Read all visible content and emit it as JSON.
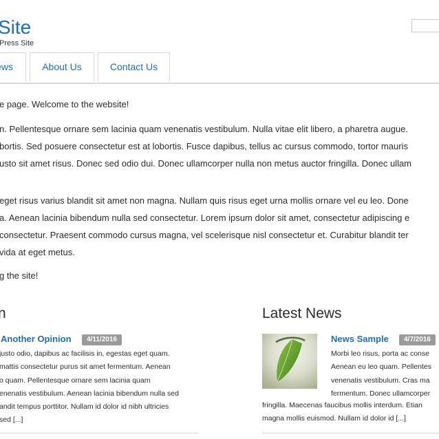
{
  "header": {
    "site_title": "Site",
    "tagline": "Press Site",
    "search": {
      "placeholder": ""
    }
  },
  "nav": {
    "items": [
      {
        "label": "ews"
      },
      {
        "label": "About Us"
      },
      {
        "label": "Contact Us"
      }
    ]
  },
  "content": {
    "intro": "e page. Welcome to the website!",
    "paragraph1": [
      "n. Pellentesque ornare sem lacinia quam venenatis vestibulum. Nulla vitae elit libero, a pharetra augue.",
      "bortis. Sed posuere consectetur est at lobortis. Fusce dapibus, tellus ac cursus commodo, tortor mauris",
      "usto sit amet risus. Donec sed odio dui. Donec ullamcorper nulla non metus auctor fringilla. Donec ullam"
    ],
    "paragraph2": [
      " eget risus varius blandit sit amet non magna. Nullam quis risus eget urna mollis ornare vel eu leo. Done",
      "a. Aenean lacinia bibendum nulla sed consectetur. Lorem ipsum dolor sit amet, consectetur adipiscing e",
      " consectetur. Praesent commodo cursus magna, vel scelerisque nisl consectetur et. Curabitur blandit ter",
      "vida at eget metus."
    ],
    "closing": "g the site!"
  },
  "opinion": {
    "section_title": "n",
    "post": {
      "title": "Another Opinion",
      "date": "4/11/2016",
      "excerpt": [
        " justo odio, dapibus ac facilisis in, egestas eget quam.",
        " mattis consectetur purus sit amet fermentum. Aenean",
        "o quam. Pellentesque ornare sem lacinia quam",
        "enenatis vestibulum. Aenean lacinia bibendum nulla sed",
        "andit tempus porttitor. Nullam id dolor id nibh ultricies",
        " sed [...]"
      ]
    }
  },
  "news": {
    "section_title": "Latest News",
    "post": {
      "title": "News Sample",
      "date": "4/7/2016",
      "thumbnail_icon": "leaf-photo",
      "excerpt_beside": [
        "Morbi leo risus, porta ac conse",
        "Aenean eu leo quam. Pellentes",
        "venenatis vestibulum. Cras ma",
        "fermentum. Donec ullamcorper"
      ],
      "excerpt_below": [
        "fringilla. Maecenas faucibus mollis interdum. Etian",
        "magna mollis euismod. Nullam id dolor id [...]"
      ]
    }
  },
  "colors": {
    "link": "#1d6fb3",
    "text": "#2b2b2b",
    "badge": "#9a9a9a",
    "border": "#d8d8d8"
  }
}
